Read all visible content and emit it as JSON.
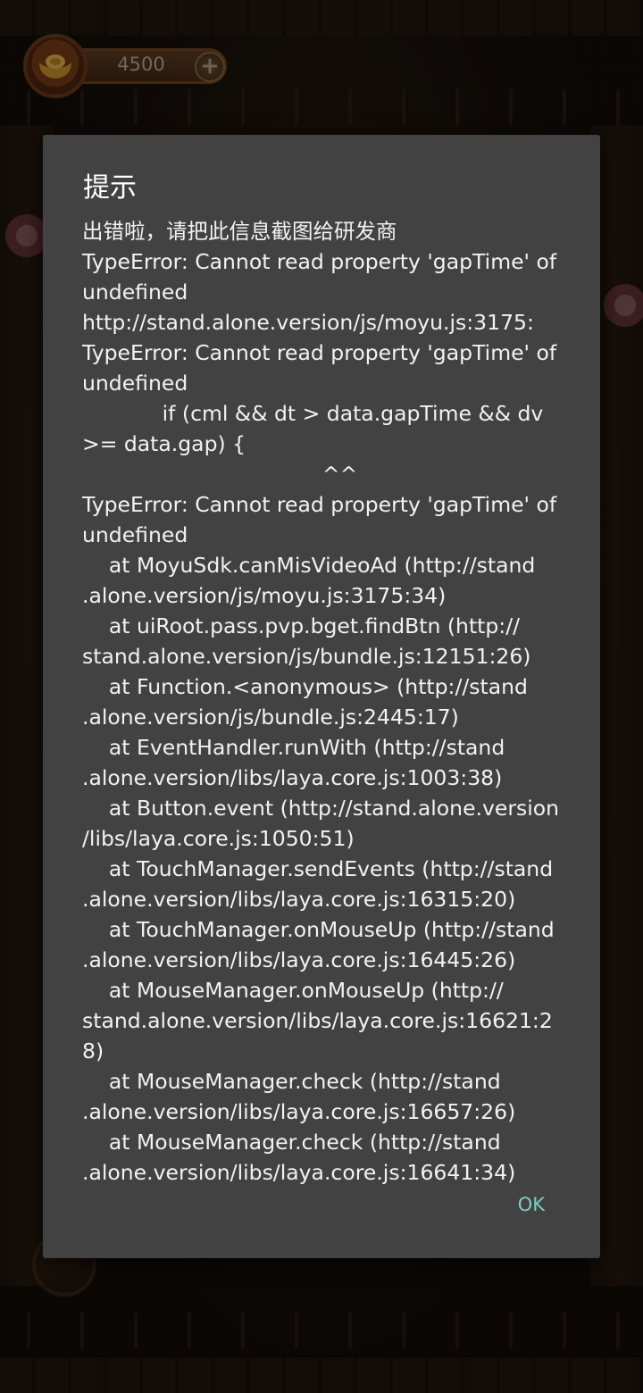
{
  "hud": {
    "currency_icon": "gold-ingot-icon",
    "currency_amount": "4500",
    "add_symbol": "+"
  },
  "dialog": {
    "title": "提示",
    "message_lines": [
      "出错啦，请把此信息截图给研发商",
      "TypeError: Cannot read property 'gapTime' of",
      "undefined",
      "http://stand.alone.version/js/moyu.js:3175:",
      "TypeError: Cannot read property 'gapTime' of",
      "undefined",
      "            if (cml && dt > data.gapTime && dv",
      ">= data.gap) {",
      "                                    ^^",
      "TypeError: Cannot read property 'gapTime' of",
      "undefined",
      "    at MoyuSdk.canMisVideoAd (http://stand",
      ".alone.version/js/moyu.js:3175:34)",
      "    at uiRoot.pass.pvp.bget.findBtn (http://",
      "stand.alone.version/js/bundle.js:12151:26)",
      "    at Function.<anonymous> (http://stand",
      ".alone.version/js/bundle.js:2445:17)",
      "    at EventHandler.runWith (http://stand",
      ".alone.version/libs/laya.core.js:1003:38)",
      "    at Button.event (http://stand.alone.version",
      "/libs/laya.core.js:1050:51)",
      "    at TouchManager.sendEvents (http://stand",
      ".alone.version/libs/laya.core.js:16315:20)",
      "    at TouchManager.onMouseUp (http://stand",
      ".alone.version/libs/laya.core.js:16445:26)",
      "    at MouseManager.onMouseUp (http://",
      "stand.alone.version/libs/laya.core.js:16621:28)",
      "    at MouseManager.check (http://stand",
      ".alone.version/libs/laya.core.js:16657:26)",
      "    at MouseManager.check (http://stand",
      ".alone.version/libs/laya.core.js:16641:34)"
    ],
    "ok_label": "OK"
  },
  "colors": {
    "dialog_bg": "#424242",
    "ok_accent": "#80cbc4",
    "text": "#f2f2f2"
  }
}
